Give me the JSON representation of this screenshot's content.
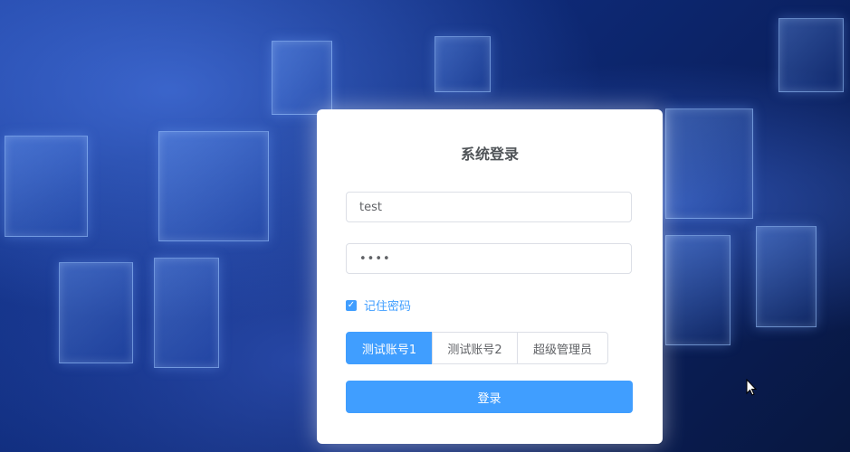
{
  "login": {
    "title": "系统登录",
    "username_value": "test",
    "password_value": "••••",
    "remember_label": "记住密码",
    "remember_checked": true,
    "account_buttons": [
      "测试账号1",
      "测试账号2",
      "超级管理员"
    ],
    "login_button": "登录"
  },
  "icons": {
    "checkbox": "check-icon",
    "cursor": "mouse-pointer-icon"
  },
  "colors": {
    "primary": "#409eff",
    "background": "#0e2a78",
    "card": "#ffffff",
    "title_text": "#505458",
    "input_border": "#dcdfe6"
  }
}
